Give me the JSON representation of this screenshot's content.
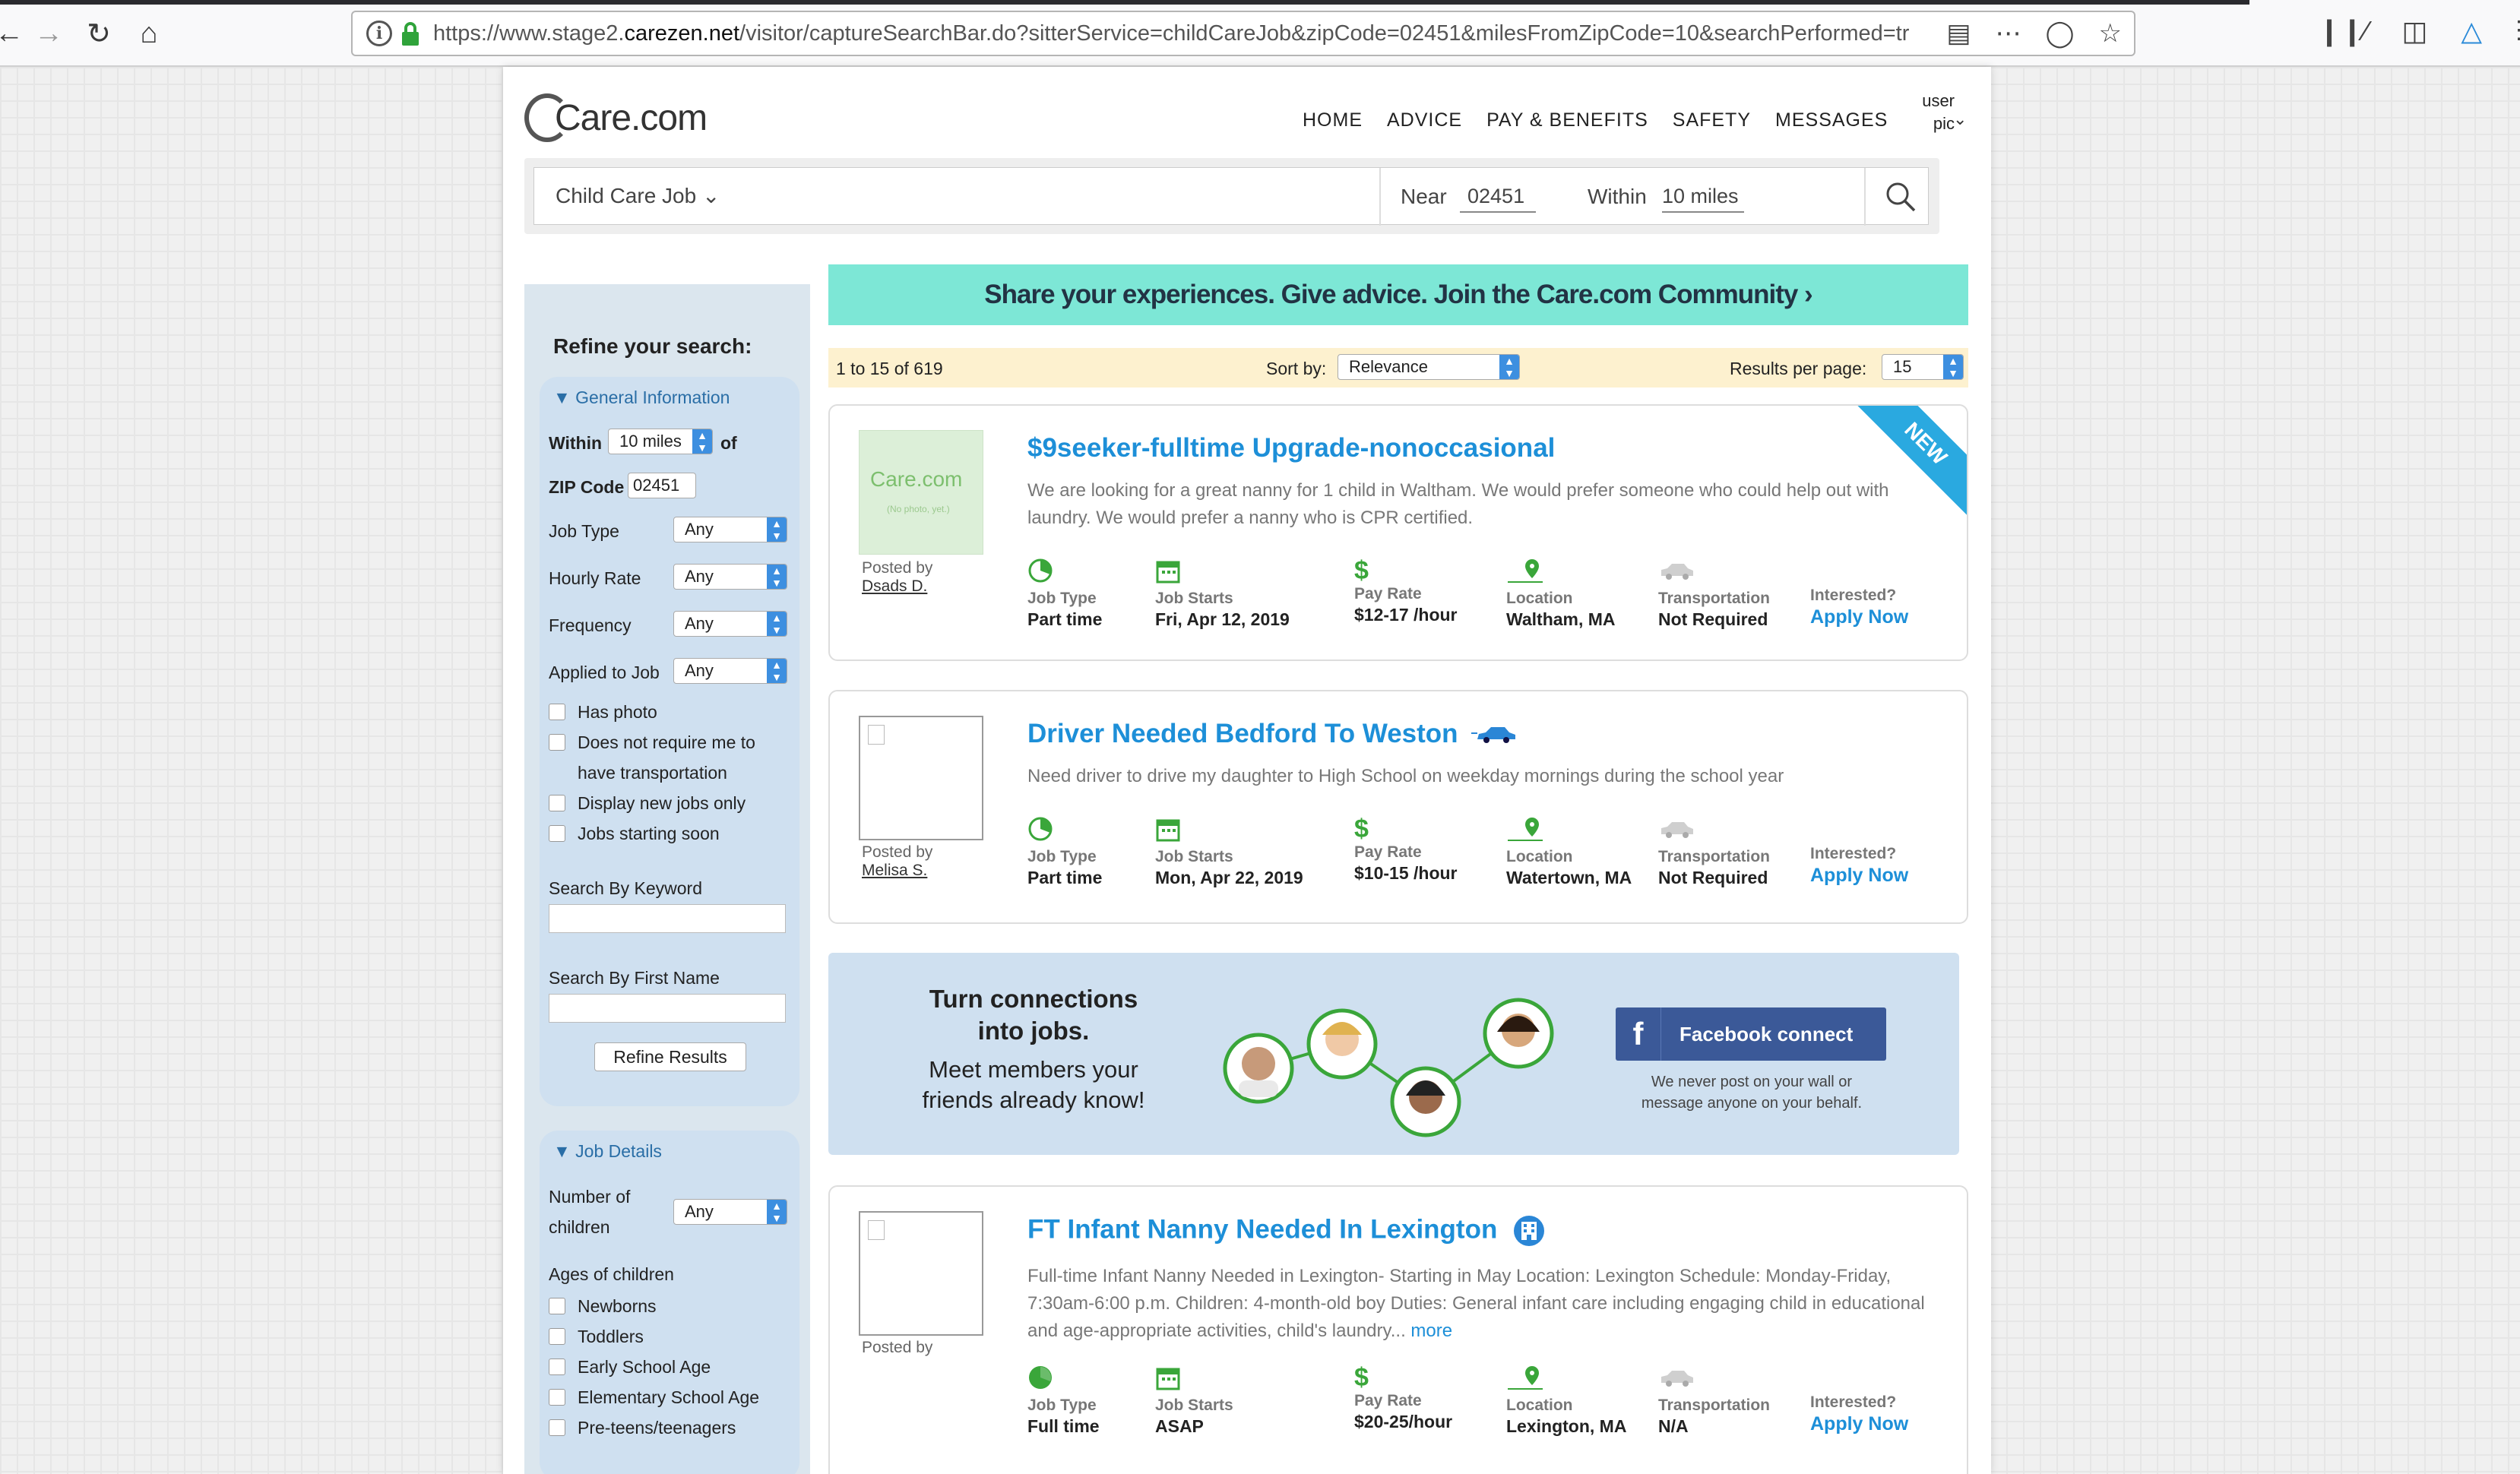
{
  "browser": {
    "url_pre": "https://www.stage2.",
    "url_domain": "carezen.net",
    "url_post": "/visitor/captureSearchBar.do?sitterService=childCareJob&zipCode=02451&milesFromZipCode=10&searchPerformed=tr"
  },
  "header": {
    "logo": "Care.com",
    "nav": [
      "HOME",
      "ADVICE",
      "PAY & BENEFITS",
      "SAFETY",
      "MESSAGES"
    ],
    "user_line1": "user",
    "user_line2": "pic"
  },
  "search": {
    "service": "Child Care Job",
    "near_label": "Near",
    "zip": "02451",
    "within_label": "Within",
    "miles": "10 miles"
  },
  "banner": "Share your experiences. Give advice. Join the Care.com Community ›",
  "results": {
    "count": "1 to 15 of 619",
    "sort_label": "Sort by:",
    "sort_value": "Relevance",
    "per_page_label": "Results per page:",
    "per_page_value": "15"
  },
  "sidebar": {
    "title": "Refine your search:",
    "general_title": "▼ General Information",
    "within_label": "Within",
    "within_value": "10 miles",
    "of_label": "of",
    "zip_label": "ZIP Code",
    "zip_value": "02451",
    "filters": [
      {
        "label": "Job Type",
        "value": "Any"
      },
      {
        "label": "Hourly Rate",
        "value": "Any"
      },
      {
        "label": "Frequency",
        "value": "Any"
      },
      {
        "label": "Applied to Job",
        "value": "Any"
      }
    ],
    "checks": [
      "Has photo",
      "Does not require me to",
      "have transportation",
      "Display new jobs only",
      "Jobs starting soon"
    ],
    "keyword_label": "Search By Keyword",
    "firstname_label": "Search By First Name",
    "refine_button": "Refine Results",
    "details_title": "▼ Job Details",
    "children_label_1": "Number of",
    "children_label_2": "children",
    "children_value": "Any",
    "ages_label": "Ages of children",
    "ages": [
      "Newborns",
      "Toddlers",
      "Early School Age",
      "Elementary School Age",
      "Pre-teens/teenagers"
    ]
  },
  "field_labels": {
    "job_type": "Job Type",
    "job_starts": "Job Starts",
    "pay_rate": "Pay Rate",
    "location": "Location",
    "transportation": "Transportation",
    "interested": "Interested?",
    "apply": "Apply Now",
    "posted_by": "Posted by"
  },
  "jobs": [
    {
      "title": "$9seeker-fulltime Upgrade-nonoccasional",
      "desc": "We are looking for a great nanny for 1 child in Waltham. We would prefer someone who could help out with laundry. We would prefer a nanny who is CPR certified.",
      "posted_by": "Dsads D.",
      "job_type": "Part time",
      "job_starts": "Fri, Apr 12, 2019",
      "pay_rate": "$12-17 /hour",
      "location": "Waltham, MA",
      "transportation": "Not Required",
      "badge": "NEW",
      "photo_logo": "Care.com",
      "photo_note": "(No photo, yet.)"
    },
    {
      "title": "Driver Needed Bedford To Weston",
      "desc": "Need driver to drive my daughter to High School on weekday mornings during the school year",
      "posted_by": "Melisa S.",
      "job_type": "Part time",
      "job_starts": "Mon, Apr 22, 2019",
      "pay_rate": "$10-15 /hour",
      "location": "Watertown, MA",
      "transportation": "Not Required"
    },
    {
      "title": "FT Infant Nanny Needed In Lexington",
      "desc": "Full-time Infant Nanny Needed in Lexington- Starting in May Location: Lexington Schedule: Monday-Friday, 7:30am-6:00 p.m. Children: 4-month-old boy Duties: General infant care including engaging child in educational and age-appropriate activities, child's laundry...",
      "more": "more",
      "posted_by": "",
      "job_type": "Full time",
      "job_starts": "ASAP",
      "pay_rate": "$20-25/hour",
      "location": "Lexington, MA",
      "transportation": "N/A"
    }
  ],
  "promo": {
    "headline_1": "Turn connections",
    "headline_2": "into jobs.",
    "sub_1": "Meet members your",
    "sub_2": "friends already know!",
    "fb_button": "Facebook connect",
    "note_1": "We never post on your wall or",
    "note_2": "message anyone on your behalf."
  },
  "colors": {
    "accent": "#1d8fd8",
    "banner": "#7de7d6",
    "sidebar": "#dbe6ee",
    "facebook": "#3b5998",
    "green_icon": "#3aa63a"
  }
}
